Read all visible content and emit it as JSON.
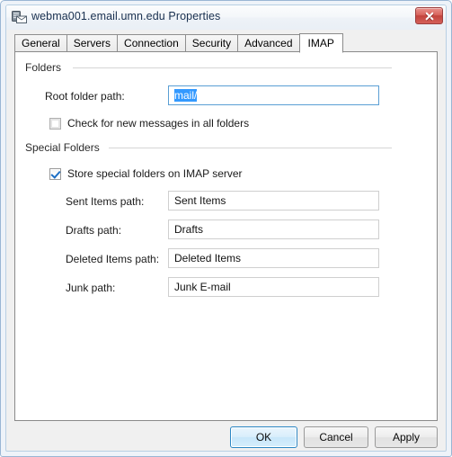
{
  "window": {
    "title": "webma001.email.umn.edu Properties",
    "icon": "server-mail-icon",
    "close_label": "Close"
  },
  "tabs": [
    {
      "label": "General",
      "active": false
    },
    {
      "label": "Servers",
      "active": false
    },
    {
      "label": "Connection",
      "active": false
    },
    {
      "label": "Security",
      "active": false
    },
    {
      "label": "Advanced",
      "active": false
    },
    {
      "label": "IMAP",
      "active": true
    }
  ],
  "folders_group": {
    "title": "Folders",
    "root_folder_label": "Root folder path:",
    "root_folder_value": "mail/",
    "root_folder_selected": true,
    "check_new_messages_label": "Check for new messages in all folders",
    "check_new_messages_checked": false
  },
  "special_folders_group": {
    "title": "Special Folders",
    "store_special_label": "Store special folders on IMAP server",
    "store_special_checked": true,
    "fields": [
      {
        "label": "Sent Items path:",
        "value": "Sent Items"
      },
      {
        "label": "Drafts path:",
        "value": "Drafts"
      },
      {
        "label": "Deleted Items path:",
        "value": "Deleted Items"
      },
      {
        "label": "Junk path:",
        "value": "Junk E-mail"
      }
    ]
  },
  "footer": {
    "ok_label": "OK",
    "cancel_label": "Cancel",
    "apply_label": "Apply"
  },
  "colors": {
    "accent": "#3399ff",
    "frame": "#9ab6d4",
    "close_red": "#c2433c",
    "default_button_border": "#2c87c4"
  }
}
